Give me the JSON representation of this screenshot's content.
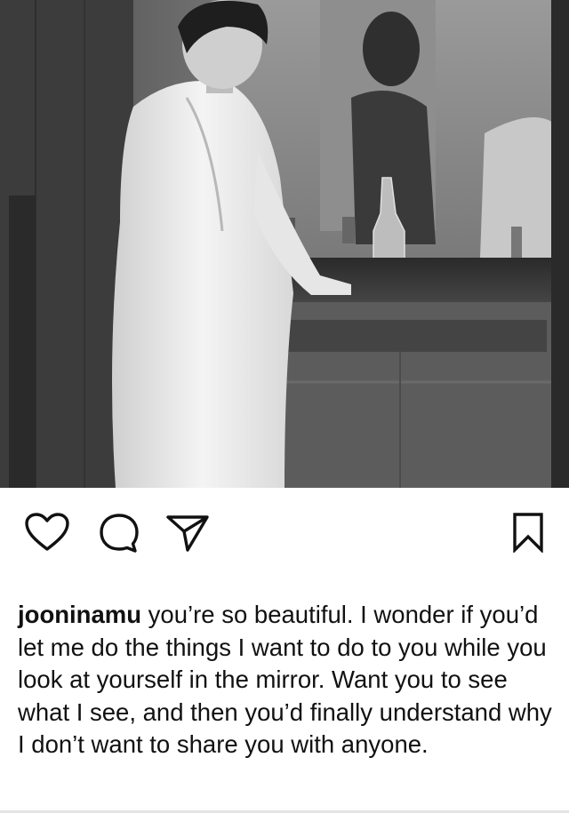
{
  "post": {
    "image_alt": "black and white photo of a man in a white bathrobe standing at a mirror and sink counter",
    "actions": {
      "like": "heart-icon",
      "comment": "speech-bubble-icon",
      "share": "paper-plane-icon",
      "save": "bookmark-icon"
    },
    "caption": {
      "username": "jooninamu",
      "text": "you’re so beautiful. I wonder if you’d let me do the things I want to do to you while you look at yourself in the mirror. Want you to see what I see, and then you’d finally understand why I don’t want to share you with anyone."
    }
  },
  "colors": {
    "icon_stroke": "#111111",
    "background": "#ffffff"
  }
}
